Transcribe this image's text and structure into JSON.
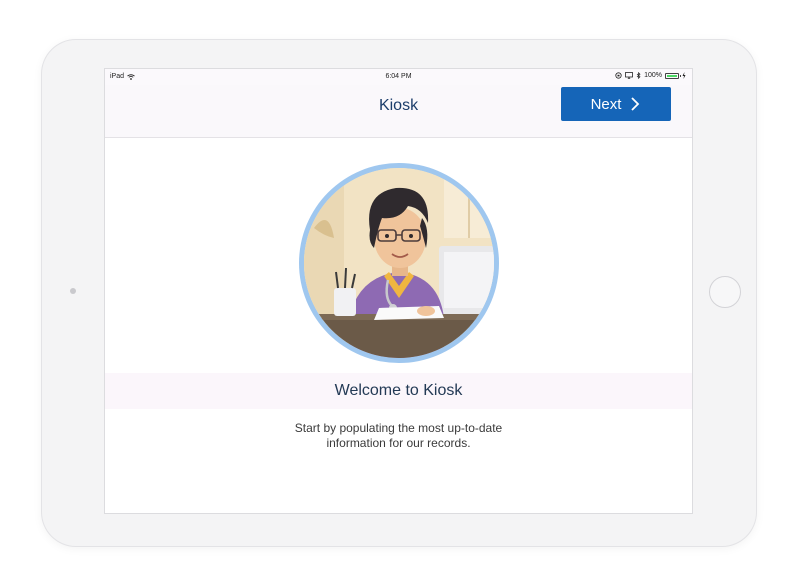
{
  "status_bar": {
    "carrier": "iPad",
    "time": "6:04 PM",
    "battery_percent": "100%"
  },
  "nav": {
    "title": "Kiosk",
    "next_label": "Next"
  },
  "main": {
    "welcome_title": "Welcome to Kiosk",
    "subtitle_line1": "Start by populating the most up-to-date",
    "subtitle_line2": "information for our records."
  },
  "colors": {
    "accent": "#1565b8",
    "title_text": "#1b3d6a",
    "avatar_ring": "#9fc7ef"
  },
  "icons": [
    "wifi-icon",
    "lock-rotation-icon",
    "airplay-icon",
    "bluetooth-icon",
    "battery-icon",
    "charging-icon",
    "chevron-right-icon"
  ]
}
